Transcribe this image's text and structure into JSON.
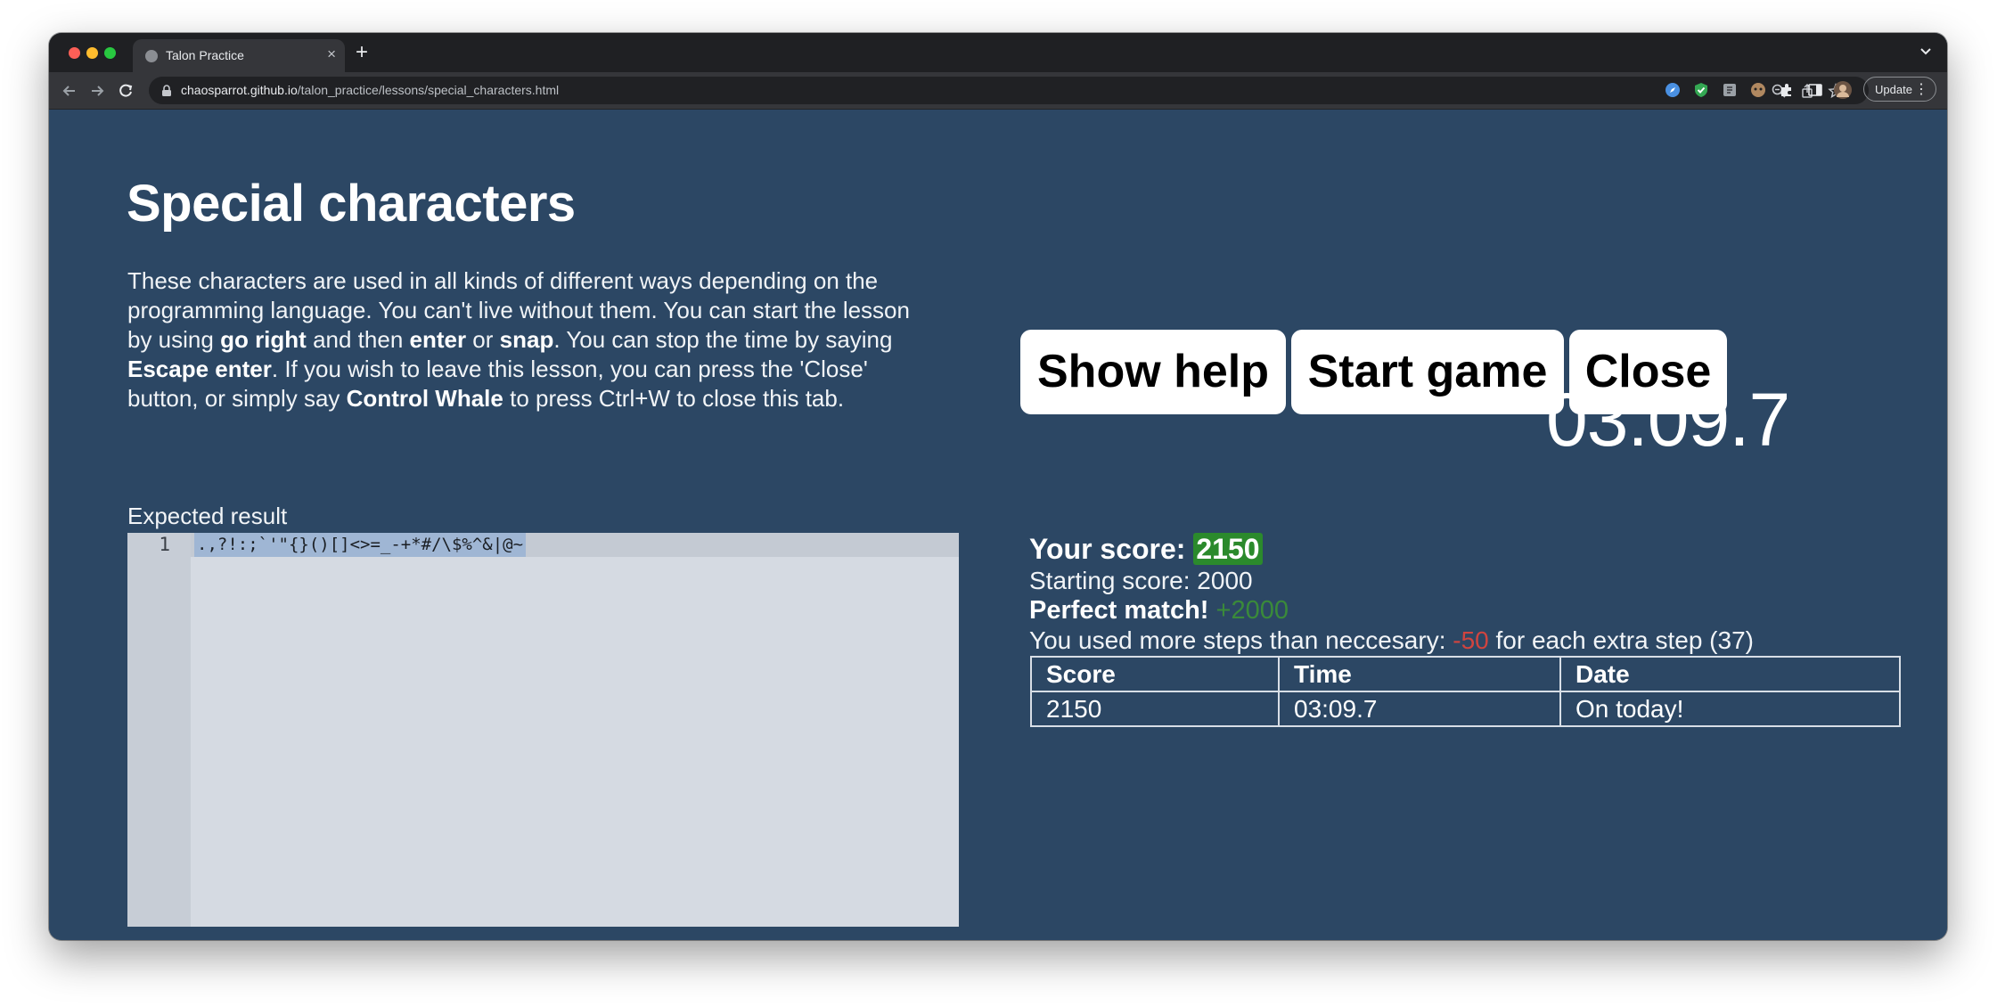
{
  "browser": {
    "tab_title": "Talon Practice",
    "tab_close": "×",
    "new_tab": "+",
    "url_host": "chaosparrot.github.io",
    "url_path": "/talon_practice/lessons/special_characters.html",
    "update_label": "Update",
    "menu_glyph": "⋮"
  },
  "lesson": {
    "title": "Special characters",
    "intro": {
      "t1": "These characters are used in all kinds of different ways depending on the programming language. You can't live without them. You can start the lesson by using ",
      "b1": "go right",
      "t2": " and then ",
      "b2": "enter",
      "t3": " or ",
      "b3": "snap",
      "t4": ". You can stop the time by saying ",
      "b4": "Escape enter",
      "t5": ". If you wish to leave this lesson, you can press the 'Close' button, or simply say ",
      "b5": "Control Whale",
      "t6": " to press Ctrl+W to close this tab."
    },
    "expected_label": "Expected result",
    "editor": {
      "line_number": "1",
      "code": ".,?!:;`'\"{}()[]<>=_-+*#/\\$%^&|@~"
    }
  },
  "controls": {
    "show_help": "Show help",
    "start_game": "Start game",
    "close": "Close",
    "timer": "03:09.7"
  },
  "score": {
    "label": "Your score: ",
    "value": "2150",
    "starting": "Starting score: 2000",
    "match_label": "Perfect match!",
    "match_bonus": " +2000",
    "steps_prefix": "You used more steps than neccesary: ",
    "steps_penalty": "-50",
    "steps_suffix": " for each extra step (37)"
  },
  "results_table": {
    "headers": [
      "Score",
      "Time",
      "Date"
    ],
    "rows": [
      [
        "2150",
        "03:09.7",
        "On today!"
      ]
    ]
  },
  "colors": {
    "page_background": "#2c4764",
    "score_highlight": "#2b8a2c",
    "penalty": "#d0443f",
    "bonus": "#3a8a3a"
  }
}
